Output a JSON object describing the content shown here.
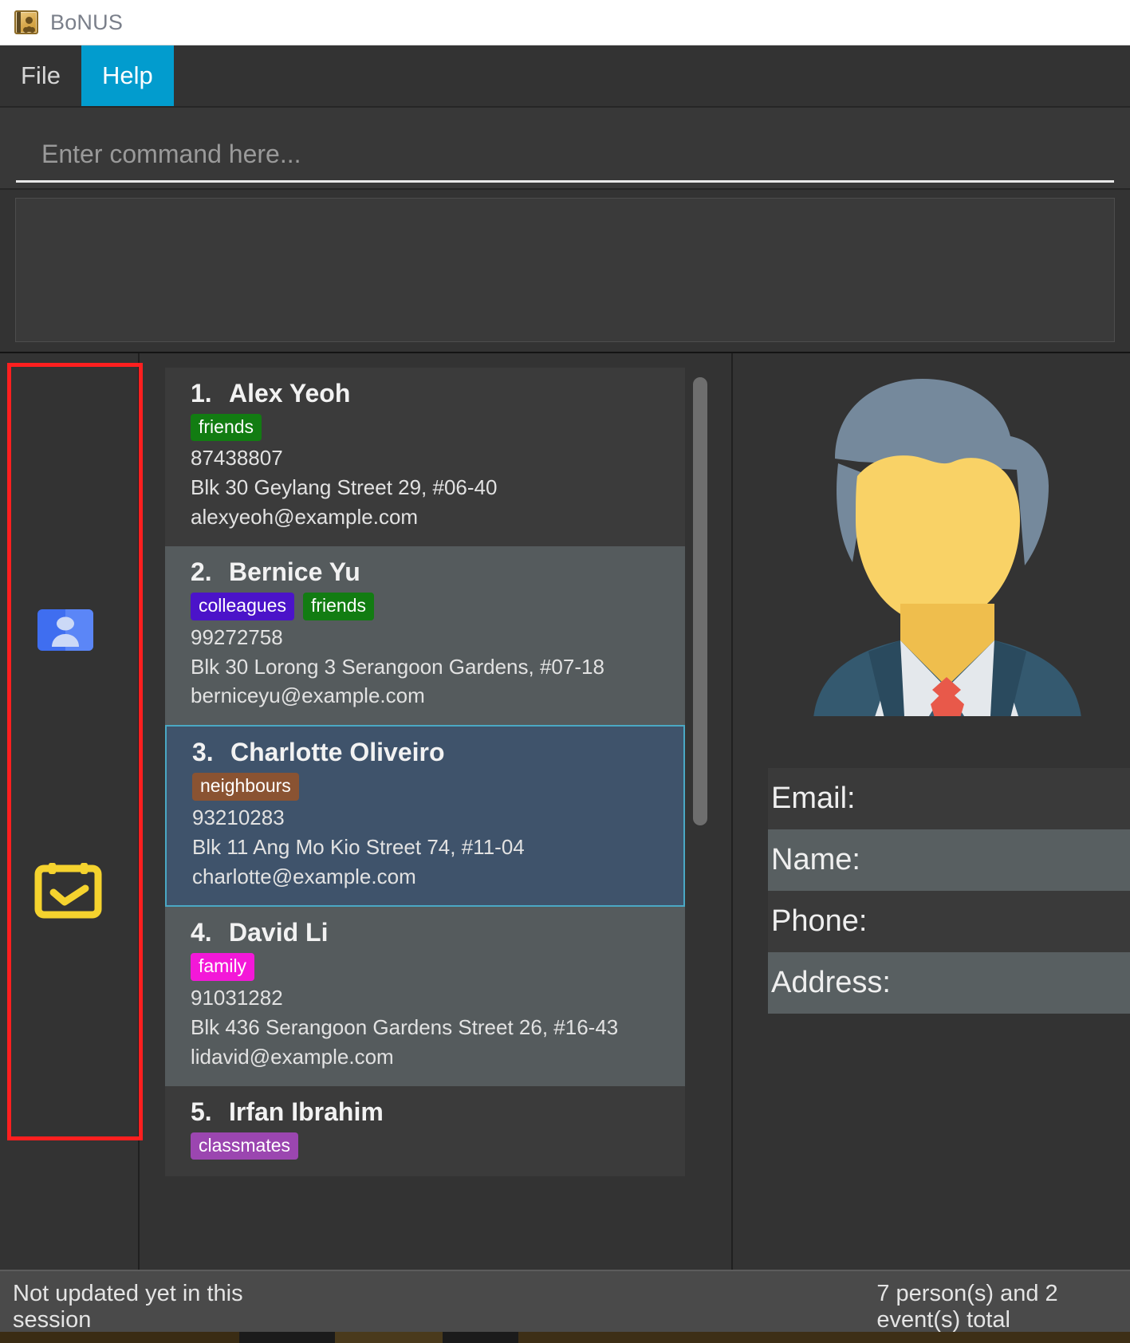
{
  "window": {
    "title": "BoNUS",
    "icon": "address-book-icon"
  },
  "menubar": {
    "items": [
      {
        "label": "File",
        "active": false
      },
      {
        "label": "Help",
        "active": true
      }
    ]
  },
  "command_box": {
    "value": "",
    "placeholder": "Enter command here..."
  },
  "result_box": {
    "text": ""
  },
  "sidebar": {
    "buttons": [
      {
        "name": "contacts-nav-button",
        "icon": "contacts-book-icon",
        "label": "Contacts"
      },
      {
        "name": "events-nav-button",
        "icon": "calendar-check-icon",
        "label": "Events"
      }
    ],
    "highlight_color": "#fe1f1f"
  },
  "person_list": {
    "persons": [
      {
        "index": "1.",
        "name": "Alex Yeoh",
        "tags": [
          {
            "label": "friends",
            "color": "#127c12"
          }
        ],
        "phone": "87438807",
        "address": "Blk 30 Geylang Street 29, #06-40",
        "email": "alexyeoh@example.com",
        "selected": false
      },
      {
        "index": "2.",
        "name": "Bernice Yu",
        "tags": [
          {
            "label": "colleagues",
            "color": "#4b13c9"
          },
          {
            "label": "friends",
            "color": "#127c12"
          }
        ],
        "phone": "99272758",
        "address": "Blk 30 Lorong 3 Serangoon Gardens, #07-18",
        "email": "berniceyu@example.com",
        "selected": false
      },
      {
        "index": "3.",
        "name": "Charlotte Oliveiro",
        "tags": [
          {
            "label": "neighbours",
            "color": "#8a5332"
          }
        ],
        "phone": "93210283",
        "address": "Blk 11 Ang Mo Kio Street 74, #11-04",
        "email": "charlotte@example.com",
        "selected": true
      },
      {
        "index": "4.",
        "name": "David Li",
        "tags": [
          {
            "label": "family",
            "color": "#f318d8"
          }
        ],
        "phone": "91031282",
        "address": "Blk 436 Serangoon Gardens Street 26, #16-43",
        "email": "lidavid@example.com",
        "selected": false
      },
      {
        "index": "5.",
        "name": "Irfan Ibrahim",
        "tags": [
          {
            "label": "classmates",
            "color": "#9b46b0"
          }
        ],
        "phone": "",
        "address": "",
        "email": "",
        "selected": false
      }
    ]
  },
  "detail_panel": {
    "avatar": "person-placeholder-avatar",
    "rows": [
      {
        "label": "Email:",
        "value": ""
      },
      {
        "label": "Name:",
        "value": ""
      },
      {
        "label": "Phone:",
        "value": ""
      },
      {
        "label": "Address:",
        "value": ""
      }
    ]
  },
  "statusbar": {
    "left": "Not updated yet in this session",
    "right": "7 person(s) and 2 event(s) total"
  }
}
